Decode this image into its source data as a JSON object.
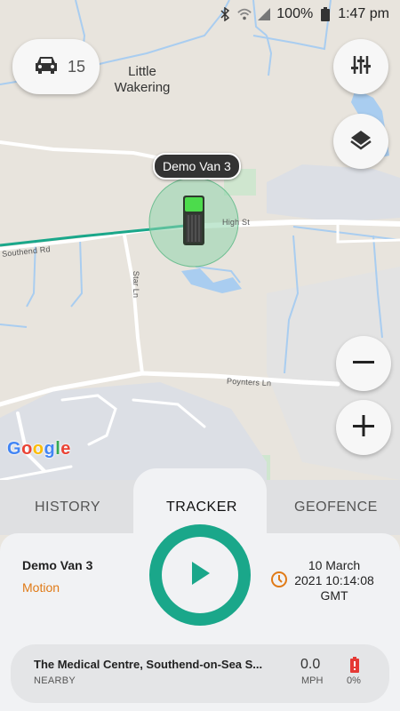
{
  "status_bar": {
    "battery_percent": "100%",
    "time": "1:47 pm",
    "icons": [
      "bluetooth-icon",
      "wifi-icon",
      "signal-icon",
      "battery-icon"
    ]
  },
  "map": {
    "vehicle_count": "15",
    "place_label": "Little Wakering",
    "roads": [
      "High St",
      "Southend Rd",
      "Star Ln",
      "Poynters Ln"
    ],
    "vehicle_tag": "Demo Van 3",
    "provider_logo": "Google",
    "controls": {
      "filter_icon": "sliders-icon",
      "layers_icon": "layers-icon",
      "zoom_out_icon": "minus-icon",
      "zoom_in_icon": "plus-icon",
      "vehicle_icon": "car-icon"
    }
  },
  "tabs": [
    {
      "label": "HISTORY",
      "active": false
    },
    {
      "label": "TRACKER",
      "active": true
    },
    {
      "label": "GEOFENCE",
      "active": false
    }
  ],
  "tracker": {
    "vehicle_name": "Demo Van 3",
    "status": "Motion",
    "date_line1": "10 March",
    "date_line2": "2021 10:14:08",
    "timezone": "GMT"
  },
  "location": {
    "title": "The Medical Centre, Southend-on-Sea S...",
    "subtitle": "NEARBY",
    "speed": "0.0",
    "speed_unit": "MPH",
    "battery": "0%"
  },
  "colors": {
    "accent": "#1aa78a",
    "status_orange": "#e07a16",
    "battery_red": "#e53935",
    "route": "#1aa78a"
  }
}
